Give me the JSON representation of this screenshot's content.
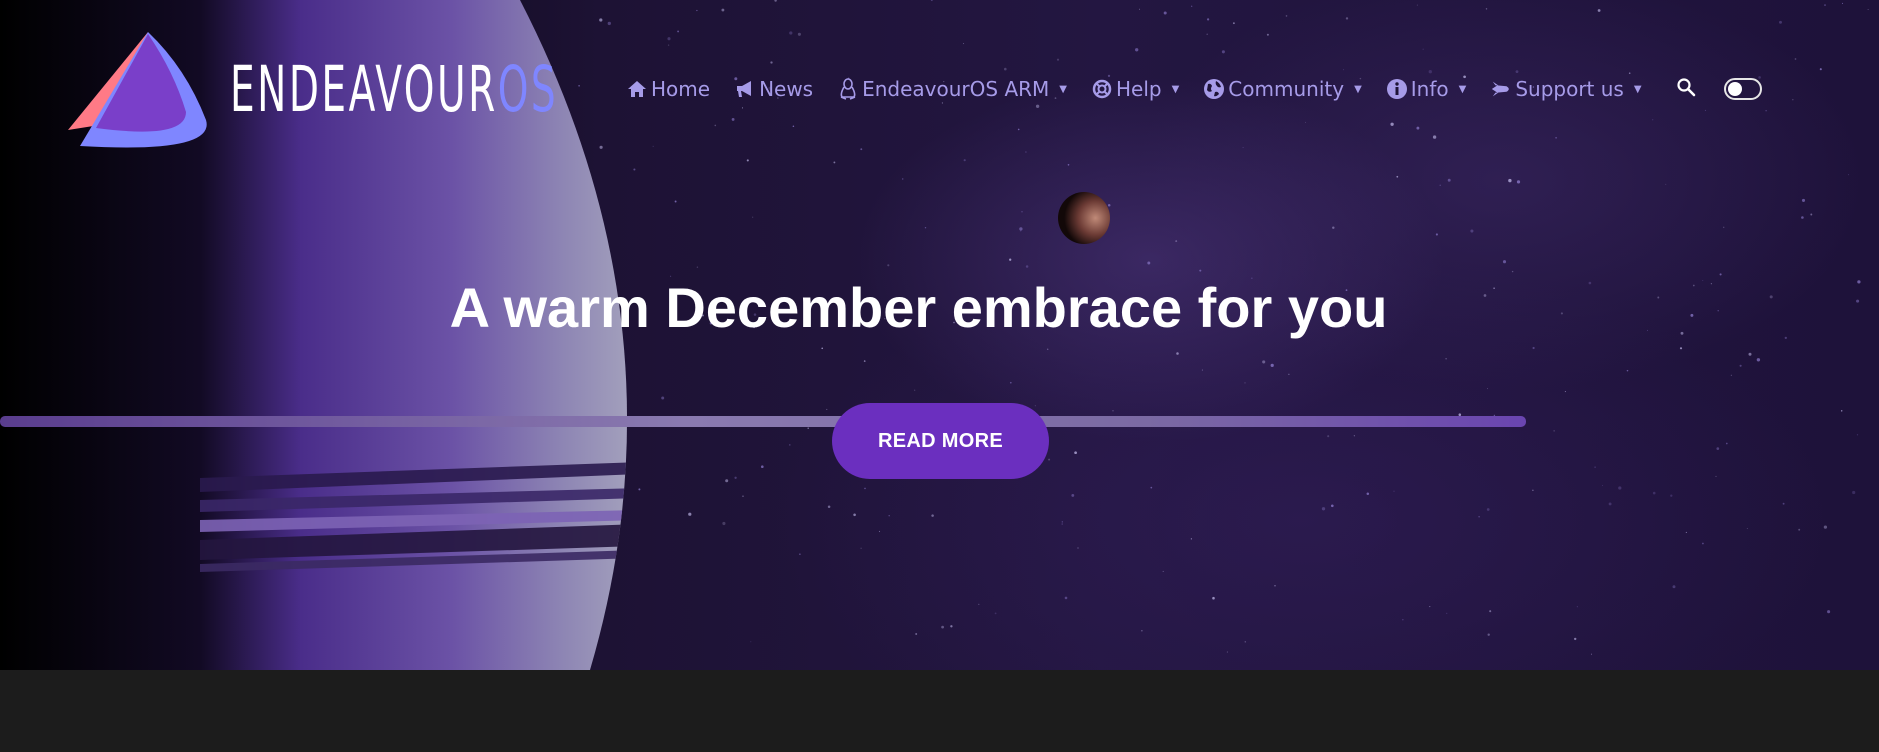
{
  "brand": {
    "name_main": "ENDEAVOUR",
    "name_suffix": "OS",
    "logo_icon": "endeavouros-triangle-logo",
    "colors": {
      "accent": "#7f86ff",
      "logo_pink": "#ff7a86",
      "logo_purple": "#7a3fc9"
    }
  },
  "nav": {
    "items": [
      {
        "label": "Home",
        "icon": "home-icon",
        "dropdown": false
      },
      {
        "label": "News",
        "icon": "megaphone-icon",
        "dropdown": false
      },
      {
        "label": "EndeavourOS ARM",
        "icon": "linux-tux-icon",
        "dropdown": true
      },
      {
        "label": "Help",
        "icon": "lifebuoy-icon",
        "dropdown": true
      },
      {
        "label": "Community",
        "icon": "globe-icon",
        "dropdown": true
      },
      {
        "label": "Info",
        "icon": "info-icon",
        "dropdown": true
      },
      {
        "label": "Support us",
        "icon": "rocket-icon",
        "dropdown": true
      }
    ],
    "search_icon": "search-icon",
    "theme_toggle": "dark-mode-toggle",
    "color": "#a69be8"
  },
  "hero": {
    "headline": "A warm December embrace for you",
    "cta_label": "READ MORE",
    "cta_color": "#6b2fbf"
  }
}
